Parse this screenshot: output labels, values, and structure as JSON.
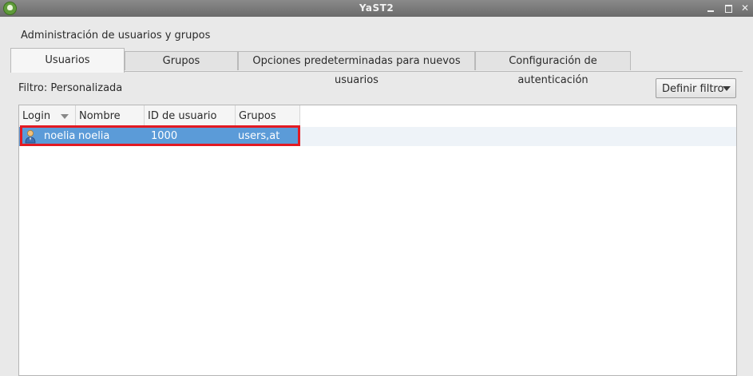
{
  "window": {
    "title": "YaST2",
    "controls": [
      "minimize-icon",
      "maximize-icon",
      "close-icon"
    ]
  },
  "page": {
    "heading": "Administración de usuarios y grupos"
  },
  "tabs": [
    {
      "label": "Usuarios",
      "active": true
    },
    {
      "label": "Grupos",
      "active": false
    },
    {
      "label": "Opciones predeterminadas para nuevos usuarios",
      "active": false
    },
    {
      "label": "Configuración de autenticación",
      "active": false
    }
  ],
  "filter": {
    "label": "Filtro: Personalizada",
    "button_label": "Definir filtro"
  },
  "table": {
    "columns": [
      "Login",
      "Nombre",
      "ID de usuario",
      "Grupos"
    ],
    "sort_column": "Login",
    "rows": [
      {
        "icon": "user-icon",
        "login": "noelia",
        "name": "noelia",
        "uid": "1000",
        "groups": "users,at",
        "selected": true
      }
    ]
  },
  "colors": {
    "selection": "#5b9bd8",
    "highlight_box": "#e21a22"
  }
}
